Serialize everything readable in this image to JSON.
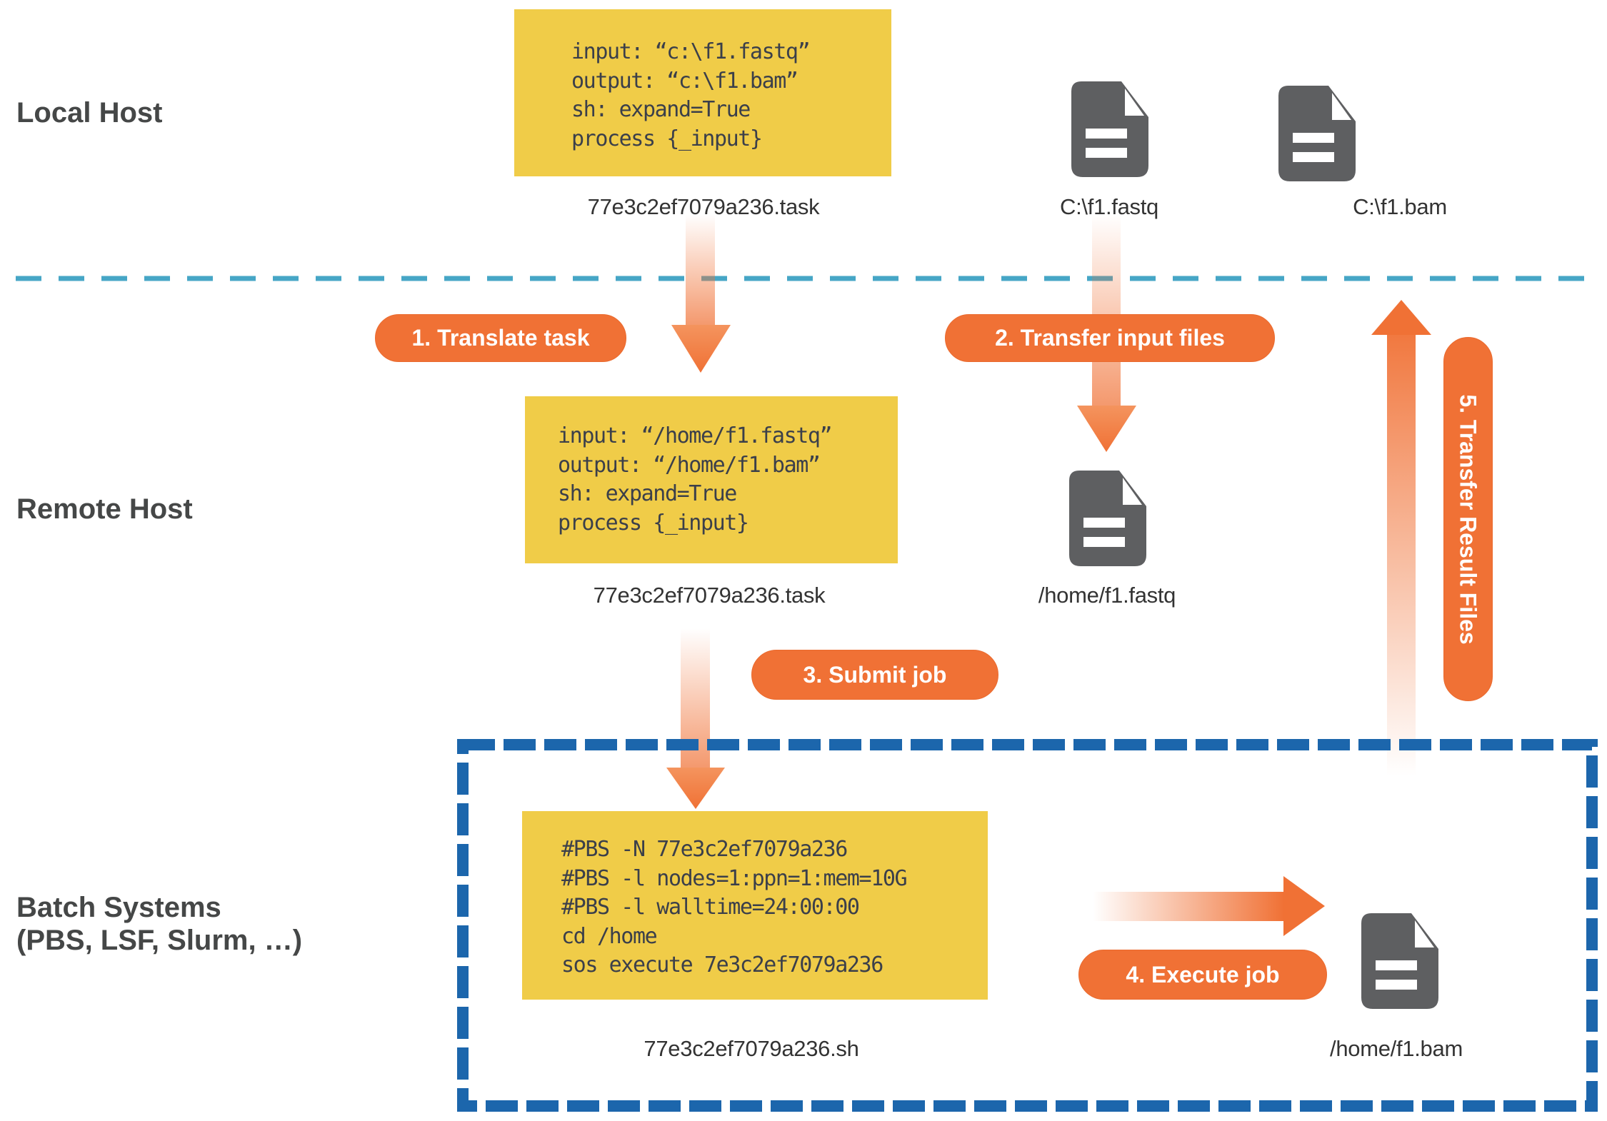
{
  "sections": {
    "local": "Local Host",
    "remote": "Remote Host",
    "batch_line1": "Batch Systems",
    "batch_line2": "(PBS, LSF, Slurm, …)"
  },
  "local_task": {
    "lines": [
      "input: “c:\\f1.fastq”",
      "output: “c:\\f1.bam”",
      "sh: expand=True",
      "process {_input}"
    ],
    "caption": "77e3c2ef7079a236.task"
  },
  "local_files": [
    {
      "icon": "file-icon",
      "caption": "C:\\f1.fastq"
    },
    {
      "icon": "file-icon",
      "caption": "C:\\f1.bam"
    }
  ],
  "remote_task": {
    "lines": [
      "input: “/home/f1.fastq”",
      "output: “/home/f1.bam”",
      "sh: expand=True",
      "process {_input}"
    ],
    "caption": "77e3c2ef7079a236.task"
  },
  "remote_files": [
    {
      "icon": "file-icon",
      "caption": "/home/f1.fastq"
    }
  ],
  "batch_script": {
    "lines": [
      "#PBS -N 77e3c2ef7079a236",
      "#PBS -l nodes=1:ppn=1:mem=10G",
      "#PBS -l walltime=24:00:00",
      "cd /home",
      "sos execute 7e3c2ef7079a236"
    ],
    "caption": "77e3c2ef7079a236.sh"
  },
  "batch_files": [
    {
      "icon": "file-icon",
      "caption": "/home/f1.bam"
    }
  ],
  "steps": [
    {
      "label": "1. Translate task"
    },
    {
      "label": "2. Transfer input files"
    },
    {
      "label": "3. Submit job"
    },
    {
      "label": "4. Execute job"
    },
    {
      "label": "5. Transfer Result Files"
    }
  ],
  "colors": {
    "code_bg": "#F0CC48",
    "step_pill": "#F07135",
    "arrow": "#F07135",
    "host_divider": "#46A6C6",
    "batch_border": "#1C66AC",
    "file_icon": "#5E5F61",
    "label_text": "#454747"
  }
}
